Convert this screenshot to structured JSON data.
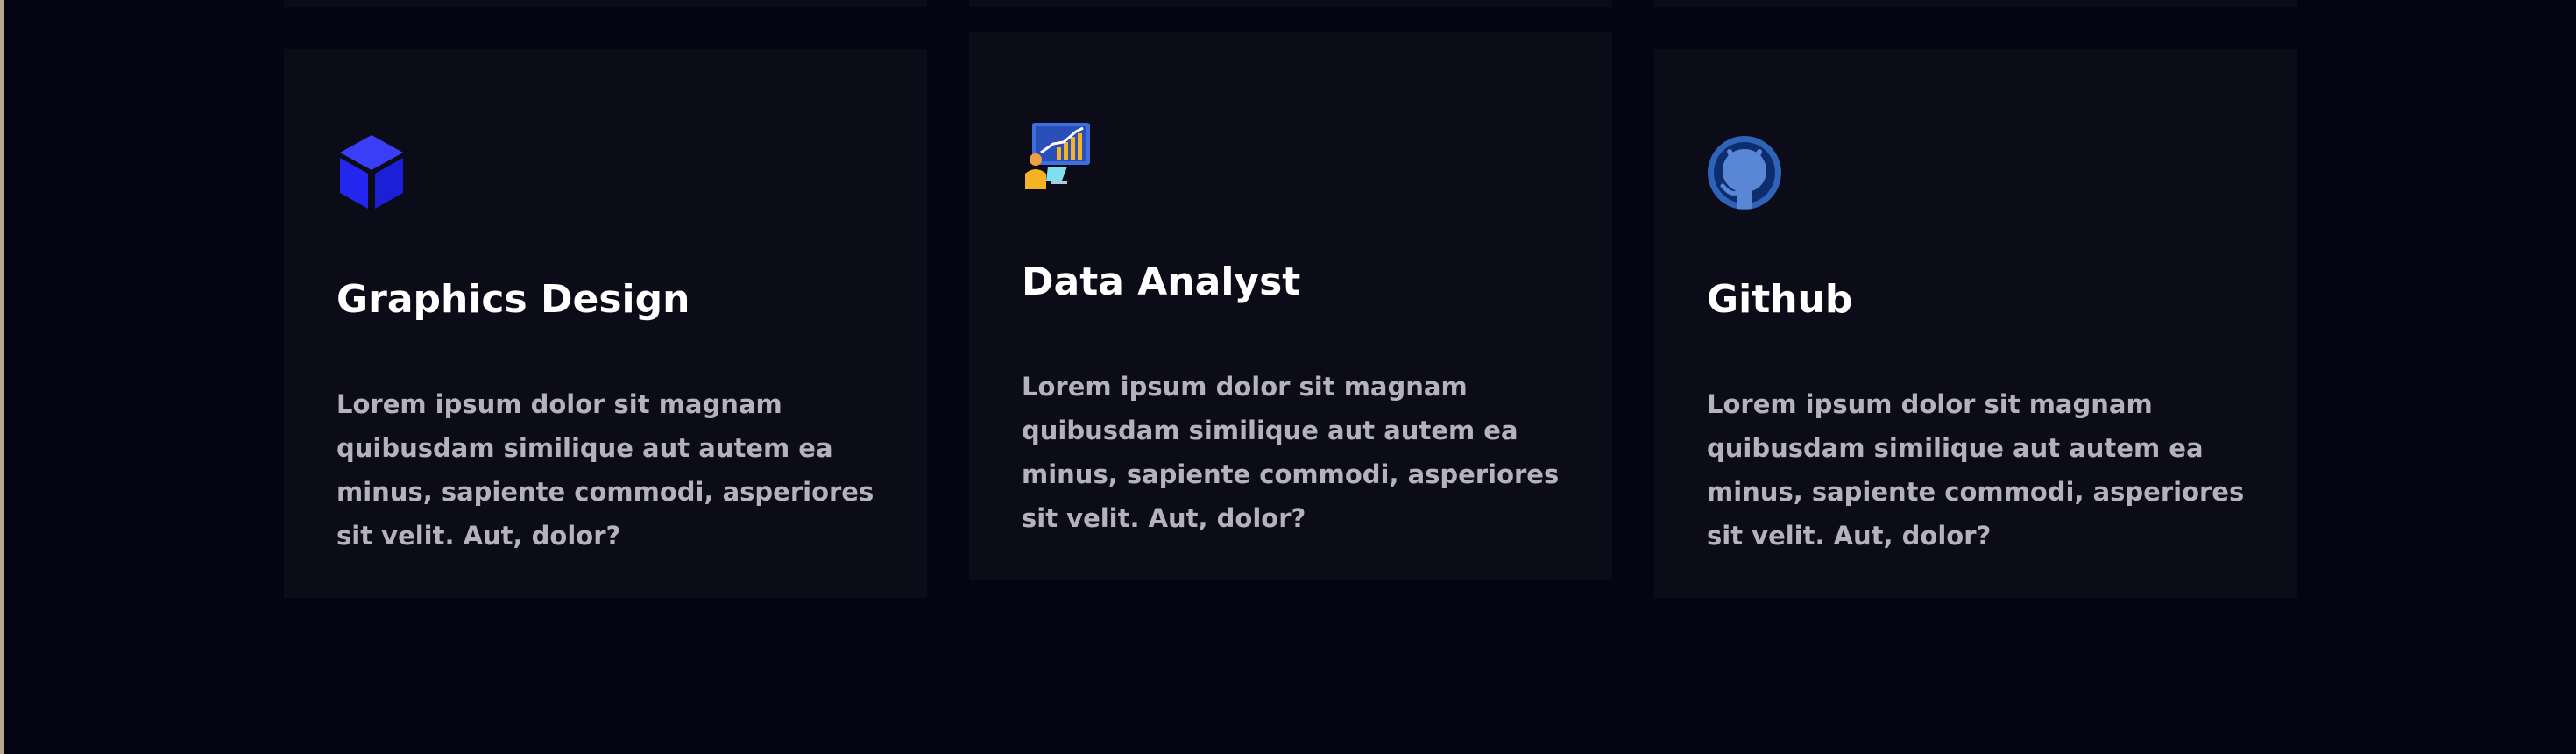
{
  "services": {
    "cards": [
      {
        "icon": "cube-icon",
        "title": "Graphics Design",
        "description": "Lorem ipsum dolor sit magnam quibusdam similique aut autem ea minus, sapiente commodi, asperiores sit velit. Aut, dolor?"
      },
      {
        "icon": "data-analytics-icon",
        "title": "Data Analyst",
        "description": "Lorem ipsum dolor sit magnam quibusdam similique aut autem ea minus, sapiente commodi, asperiores sit velit. Aut, dolor?"
      },
      {
        "icon": "github-icon",
        "title": "Github",
        "description": "Lorem ipsum dolor sit magnam quibusdam similique aut autem ea minus, sapiente commodi, asperiores sit velit. Aut, dolor?"
      }
    ]
  },
  "colors": {
    "page_background": "#050413",
    "card_background": "#0c0b18",
    "accent_blue": "#2a2df5",
    "title_text": "#ffffff",
    "body_text": "#b3b2bd"
  }
}
